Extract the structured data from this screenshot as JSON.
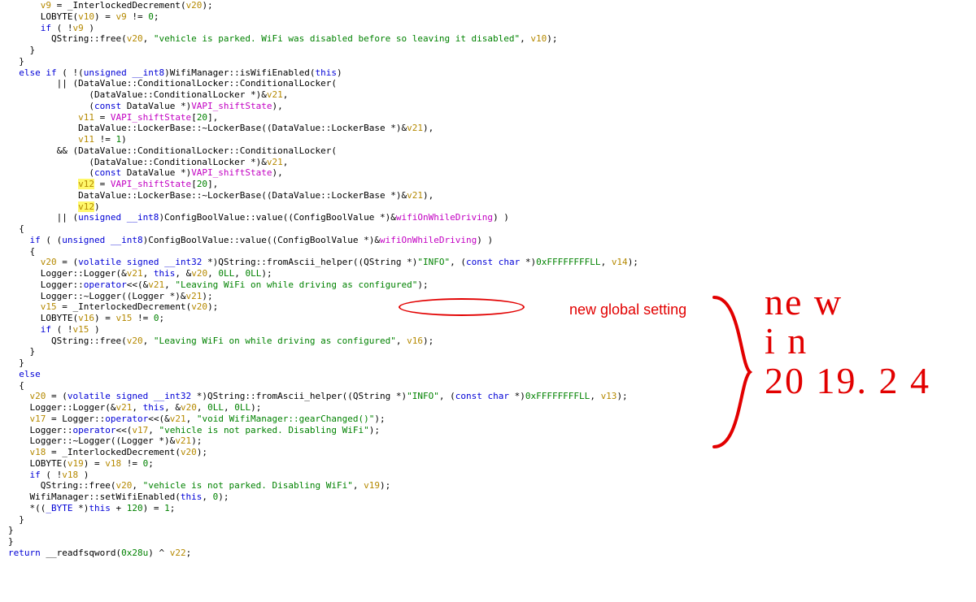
{
  "annotations": {
    "label": "new global setting",
    "handwriting_line1": "ne w",
    "handwriting_line2": "i n",
    "handwriting_line3": "20 19. 2 4"
  },
  "code": {
    "l01a": "      v9",
    "l01b": " = ",
    "l01c": "_InterlockedDecrement",
    "l01d": "(",
    "l01e": "v20",
    "l01f": ");",
    "l02a": "      LOBYTE(",
    "l02b": "v10",
    "l02c": ") = ",
    "l02d": "v9",
    "l02e": " != ",
    "l02f": "0",
    "l02g": ";",
    "l03a": "      if",
    "l03b": " ( !",
    "l03c": "v9",
    "l03d": " )",
    "l04a": "        QString::free(",
    "l04b": "v20",
    "l04c": ", ",
    "l04d": "\"vehicle is parked. WiFi was disabled before so leaving it disabled\"",
    "l04e": ", ",
    "l04f": "v10",
    "l04g": ");",
    "l05a": "    }",
    "l06a": "  }",
    "l07a": "  else if",
    "l07b": " ( !(",
    "l07c": "unsigned __int8",
    "l07d": ")WifiManager::isWifiEnabled(",
    "l07e": "this",
    "l07f": ")",
    "l08a": "         || (DataValue::ConditionalLocker::ConditionalLocker(",
    "l09a": "               (DataValue::ConditionalLocker *)&",
    "l09b": "v21",
    "l09c": ",",
    "l10a": "               (",
    "l10b": "const",
    "l10c": " DataValue *)",
    "l10d": "VAPI_shiftState",
    "l10e": "),",
    "l11a": "             v11",
    "l11b": " = ",
    "l11c": "VAPI_shiftState",
    "l11d": "[",
    "l11e": "20",
    "l11f": "],",
    "l12a": "             DataValue::LockerBase::~LockerBase((DataValue::LockerBase *)&",
    "l12b": "v21",
    "l12c": "),",
    "l13a": "             v11",
    "l13b": " != ",
    "l13c": "1",
    "l13d": ")",
    "l14a": "         && (DataValue::ConditionalLocker::ConditionalLocker(",
    "l15a": "               (DataValue::ConditionalLocker *)&",
    "l15b": "v21",
    "l15c": ",",
    "l16a": "               (",
    "l16b": "const",
    "l16c": " DataValue *)",
    "l16d": "VAPI_shiftState",
    "l16e": "),",
    "l17a": "             ",
    "l17b": "v12",
    "l17c": " = ",
    "l17d": "VAPI_shiftState",
    "l17e": "[",
    "l17f": "20",
    "l17g": "],",
    "l18a": "             DataValue::LockerBase::~LockerBase((DataValue::LockerBase *)&",
    "l18b": "v21",
    "l18c": "),",
    "l19a": "             ",
    "l19b": "v12",
    "l19c": ")",
    "l20a": "         || (",
    "l20b": "unsigned __int8",
    "l20c": ")ConfigBoolValue::value((ConfigBoolValue *)&",
    "l20d": "wifiOnWhileDriving",
    "l20e": ") )",
    "l21a": "  {",
    "l22a": "    if",
    "l22b": " ( (",
    "l22c": "unsigned __int8",
    "l22d": ")ConfigBoolValue::value((ConfigBoolValue ",
    "l22e": "*)&",
    "l22f": "wifiOnWhileDriving",
    "l22g": ")",
    "l22h": " )",
    "l23a": "    {",
    "l24a": "      v20",
    "l24b": " = (",
    "l24c": "volatile signed __int32",
    "l24d": " *)QString::fromAscii_helper((QString *)",
    "l24e": "\"INFO\"",
    "l24f": ", (",
    "l24g": "const char",
    "l24h": " *)",
    "l24i": "0xFFFFFFFFLL",
    "l24j": ", ",
    "l24k": "v14",
    "l24l": ");",
    "l25a": "      Logger::Logger(&",
    "l25b": "v21",
    "l25c": ", ",
    "l25d": "this",
    "l25e": ", &",
    "l25f": "v20",
    "l25g": ", ",
    "l25h": "0LL",
    "l25i": ", ",
    "l25j": "0LL",
    "l25k": ");",
    "l26a": "      Logger::",
    "l26b": "operator",
    "l26c": "<<(&",
    "l26d": "v21",
    "l26e": ", ",
    "l26f": "\"Leaving WiFi on while driving as configured\"",
    "l26g": ");",
    "l27a": "      Logger::~Logger((Logger *)&",
    "l27b": "v21",
    "l27c": ");",
    "l28a": "      v15",
    "l28b": " = ",
    "l28c": "_InterlockedDecrement",
    "l28d": "(",
    "l28e": "v20",
    "l28f": ");",
    "l29a": "      LOBYTE(",
    "l29b": "v16",
    "l29c": ") = ",
    "l29d": "v15",
    "l29e": " != ",
    "l29f": "0",
    "l29g": ";",
    "l30a": "      if",
    "l30b": " ( !",
    "l30c": "v15",
    "l30d": " )",
    "l31a": "        QString::free(",
    "l31b": "v20",
    "l31c": ", ",
    "l31d": "\"Leaving WiFi on while driving as configured\"",
    "l31e": ", ",
    "l31f": "v16",
    "l31g": ");",
    "l32a": "    }",
    "l33a": "  }",
    "l34a": "  else",
    "l35a": "  {",
    "l36a": "    v20",
    "l36b": " = (",
    "l36c": "volatile signed __int32",
    "l36d": " *)QString::fromAscii_helper((QString *)",
    "l36e": "\"INFO\"",
    "l36f": ", (",
    "l36g": "const char",
    "l36h": " *)",
    "l36i": "0xFFFFFFFFLL",
    "l36j": ", ",
    "l36k": "v13",
    "l36l": ");",
    "l37a": "    Logger::Logger(&",
    "l37b": "v21",
    "l37c": ", ",
    "l37d": "this",
    "l37e": ", &",
    "l37f": "v20",
    "l37g": ", ",
    "l37h": "0LL",
    "l37i": ", ",
    "l37j": "0LL",
    "l37k": ");",
    "l38a": "    v17",
    "l38b": " = Logger::",
    "l38c": "operator",
    "l38d": "<<(&",
    "l38e": "v21",
    "l38f": ", ",
    "l38g": "\"void WifiManager::gearChanged()\"",
    "l38h": ");",
    "l39a": "    Logger::",
    "l39b": "operator",
    "l39c": "<<(",
    "l39d": "v17",
    "l39e": ", ",
    "l39f": "\"vehicle is not parked. Disabling WiFi\"",
    "l39g": ");",
    "l40a": "    Logger::~Logger((Logger *)&",
    "l40b": "v21",
    "l40c": ");",
    "l41a": "    v18",
    "l41b": " = ",
    "l41c": "_InterlockedDecrement",
    "l41d": "(",
    "l41e": "v20",
    "l41f": ");",
    "l42a": "    LOBYTE(",
    "l42b": "v19",
    "l42c": ") = ",
    "l42d": "v18",
    "l42e": " != ",
    "l42f": "0",
    "l42g": ";",
    "l43a": "    if",
    "l43b": " ( !",
    "l43c": "v18",
    "l43d": " )",
    "l44a": "      QString::free(",
    "l44b": "v20",
    "l44c": ", ",
    "l44d": "\"vehicle is not parked. Disabling WiFi\"",
    "l44e": ", ",
    "l44f": "v19",
    "l44g": ");",
    "l45a": "    WifiManager::setWifiEnabled(",
    "l45b": "this",
    "l45c": ", ",
    "l45d": "0",
    "l45e": ");",
    "l46a": "    *((",
    "l46b": "_BYTE",
    "l46c": " *)",
    "l46d": "this",
    "l46e": " + ",
    "l46f": "120",
    "l46g": ") = ",
    "l46h": "1",
    "l46i": ";",
    "l47a": "  }",
    "l48a": "}",
    "l49a": "}",
    "l50a": "return",
    "l50b": " __readfsqword(",
    "l50c": "0x28u",
    "l50d": ") ^ ",
    "l50e": "v22",
    "l50f": ";"
  }
}
